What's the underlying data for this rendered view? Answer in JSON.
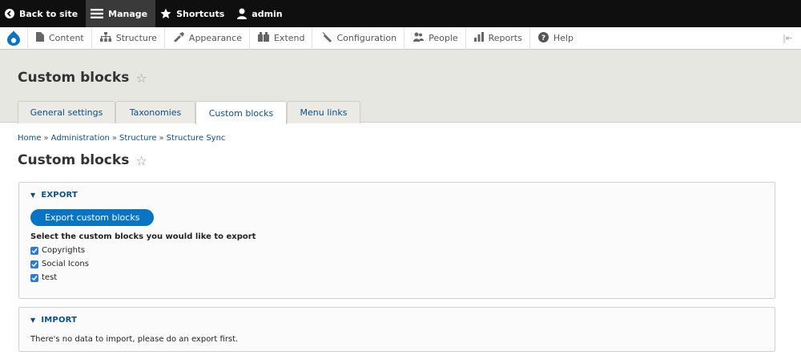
{
  "toolbar": {
    "back_label": "Back to site",
    "manage_label": "Manage",
    "shortcuts_label": "Shortcuts",
    "user_label": "admin"
  },
  "admin_menu": {
    "items": [
      {
        "label": "Content",
        "icon": "content-icon"
      },
      {
        "label": "Structure",
        "icon": "structure-icon"
      },
      {
        "label": "Appearance",
        "icon": "appearance-icon"
      },
      {
        "label": "Extend",
        "icon": "extend-icon"
      },
      {
        "label": "Configuration",
        "icon": "configuration-icon"
      },
      {
        "label": "People",
        "icon": "people-icon"
      },
      {
        "label": "Reports",
        "icon": "reports-icon"
      },
      {
        "label": "Help",
        "icon": "help-icon"
      }
    ]
  },
  "header": {
    "title": "Custom blocks",
    "tabs": [
      {
        "label": "General settings",
        "active": false
      },
      {
        "label": "Taxonomies",
        "active": false
      },
      {
        "label": "Custom blocks",
        "active": true
      },
      {
        "label": "Menu links",
        "active": false
      }
    ]
  },
  "breadcrumb": [
    {
      "label": "Home"
    },
    {
      "label": "Administration"
    },
    {
      "label": "Structure"
    },
    {
      "label": "Structure Sync"
    }
  ],
  "breadcrumb_separator": "»",
  "content": {
    "title": "Custom blocks",
    "export": {
      "legend": "EXPORT",
      "button_label": "Export custom blocks",
      "select_label": "Select the custom blocks you would like to export",
      "options": [
        {
          "label": "Copyrights",
          "checked": true
        },
        {
          "label": "Social Icons",
          "checked": true
        },
        {
          "label": "test",
          "checked": true
        }
      ]
    },
    "import": {
      "legend": "IMPORT",
      "message": "There's no data to import, please do an export first."
    }
  },
  "colors": {
    "link": "#0a4f8a",
    "primary_button": "#0874c5",
    "toolbar_bg": "#0f0f0f",
    "header_bg": "#e7e7e2"
  }
}
